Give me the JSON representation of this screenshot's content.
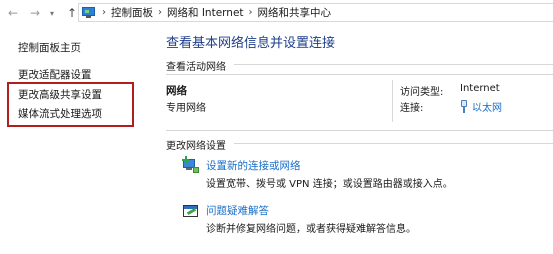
{
  "addressbar": {
    "back_icon": "arrow-left-icon",
    "forward_icon": "arrow-right-icon",
    "up_icon": "arrow-up-icon",
    "breadcrumbs": [
      "控制面板",
      "网络和 Internet",
      "网络和共享中心"
    ]
  },
  "sidebar": {
    "items": [
      {
        "label": "控制面板主页"
      },
      {
        "label": "更改适配器设置"
      },
      {
        "label": "更改高级共享设置"
      },
      {
        "label": "媒体流式处理选项"
      }
    ],
    "highlight_color": "#b01e1e"
  },
  "main": {
    "title": "查看基本网络信息并设置连接",
    "active_networks_label": "查看活动网络",
    "network": {
      "name": "网络",
      "type": "专用网络",
      "access_type_label": "访问类型:",
      "access_type_value": "Internet",
      "connections_label": "连接:",
      "connection_value": "以太网"
    },
    "change_settings_label": "更改网络设置",
    "tasks": [
      {
        "icon": "network-setup-icon",
        "link": "设置新的连接或网络",
        "desc": "设置宽带、拨号或 VPN 连接；或设置路由器或接入点。"
      },
      {
        "icon": "troubleshoot-icon",
        "link": "问题疑难解答",
        "desc": "诊断并修复网络问题，或者获得疑难解答信息。"
      }
    ],
    "title_color": "#1e3f8a",
    "link_color": "#1a6ec9"
  }
}
